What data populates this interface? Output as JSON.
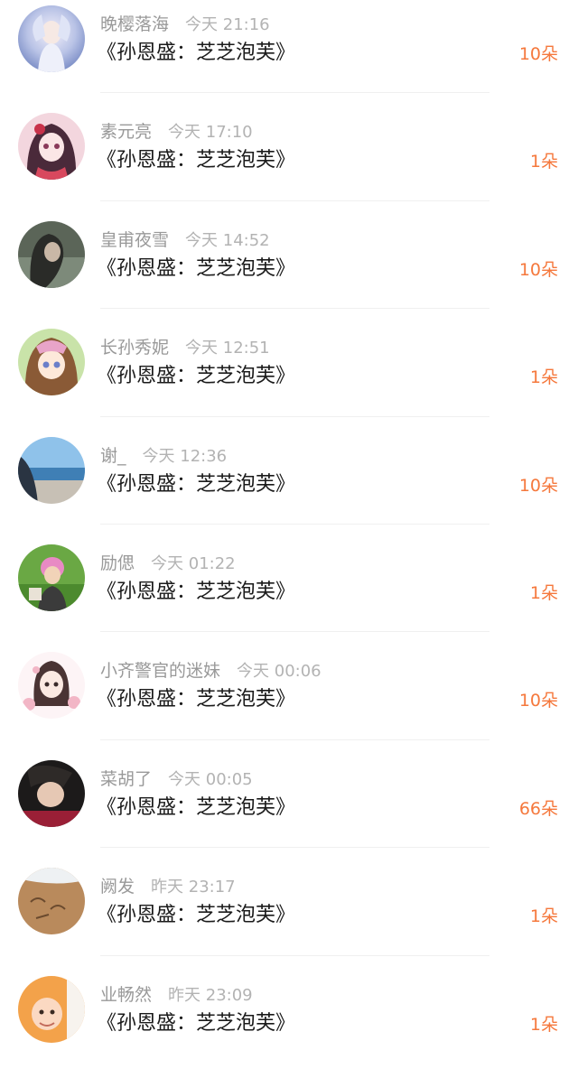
{
  "accent_color": "#f5783c",
  "items": [
    {
      "name": "晚樱落海",
      "time": "今天 21:16",
      "message": "《孙恩盛：芝芝泡芙》",
      "gift": "10朵",
      "avatar_icon": "avatar-fairy-white"
    },
    {
      "name": "素元亮",
      "time": "今天 17:10",
      "message": "《孙恩盛：芝芝泡芙》",
      "gift": "1朵",
      "avatar_icon": "avatar-anime-girl-pink"
    },
    {
      "name": "皇甫夜雪",
      "time": "今天 14:52",
      "message": "《孙恩盛：芝芝泡芙》",
      "gift": "10朵",
      "avatar_icon": "avatar-dark-photo"
    },
    {
      "name": "长孙秀妮",
      "time": "今天 12:51",
      "message": "《孙恩盛：芝芝泡芙》",
      "gift": "1朵",
      "avatar_icon": "avatar-anime-girl-brown"
    },
    {
      "name": "谢_",
      "time": "今天 12:36",
      "message": "《孙恩盛：芝芝泡芙》",
      "gift": "10朵",
      "avatar_icon": "avatar-beach"
    },
    {
      "name": "励偲",
      "time": "今天 01:22",
      "message": "《孙恩盛：芝芝泡芙》",
      "gift": "1朵",
      "avatar_icon": "avatar-pink-hair-grass"
    },
    {
      "name": "小齐警官的迷妹",
      "time": "今天 00:06",
      "message": "《孙恩盛：芝芝泡芙》",
      "gift": "10朵",
      "avatar_icon": "avatar-cartoon-girl-flowers"
    },
    {
      "name": "菜胡了",
      "time": "今天 00:05",
      "message": "《孙恩盛：芝芝泡芙》",
      "gift": "66朵",
      "avatar_icon": "avatar-portrait-dark"
    },
    {
      "name": "阙发",
      "time": "昨天 23:17",
      "message": "《孙恩盛：芝芝泡芙》",
      "gift": "1朵",
      "avatar_icon": "avatar-sand-writing"
    },
    {
      "name": "业畅然",
      "time": "昨天 23:09",
      "message": "《孙恩盛：芝芝泡芙》",
      "gift": "1朵",
      "avatar_icon": "avatar-baby"
    }
  ]
}
